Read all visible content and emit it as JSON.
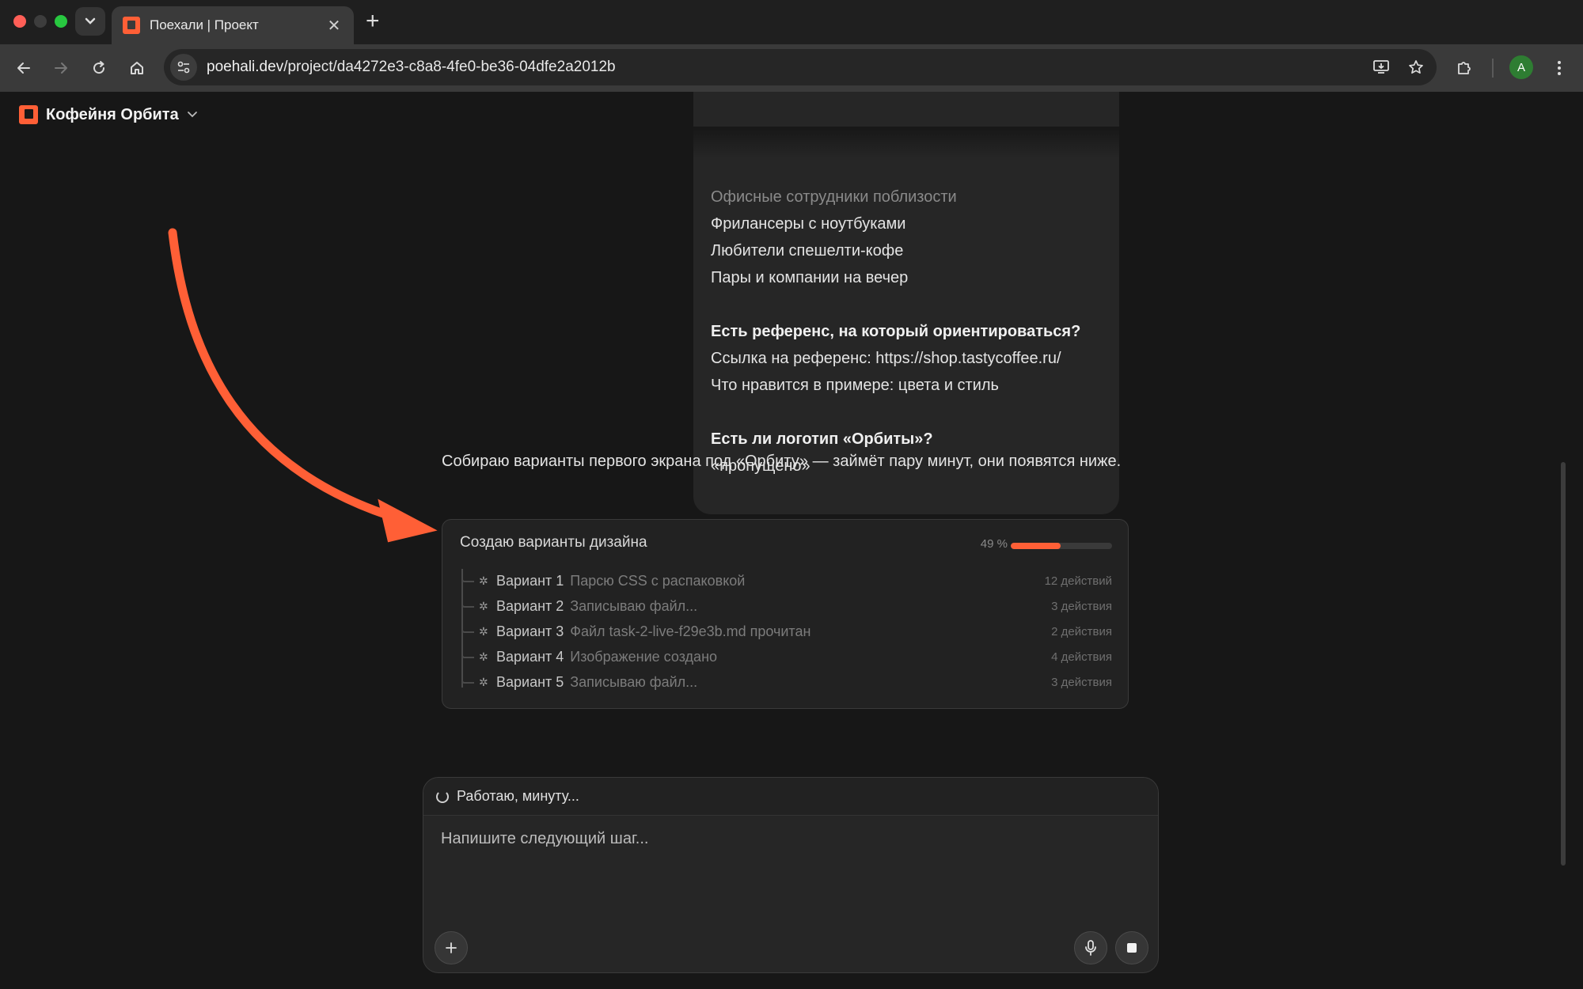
{
  "browser": {
    "tab_title": "Поехали | Проект",
    "url_host": "poehali.dev",
    "url_path": "/project/da4272e3-c8a8-4fe0-be36-04dfe2a2012b",
    "profile_initial": "A"
  },
  "header": {
    "project_name": "Кофейня Орбита"
  },
  "bubble": {
    "faded_line": "Офисные сотрудники поблизости",
    "audience": [
      "Фрилансеры с ноутбуками",
      "Любители спешелти-кофе",
      "Пары и компании на вечер"
    ],
    "q_reference": "Есть референс, на который ориентироваться?",
    "ref_link": "Ссылка на референс: https://shop.tastycoffee.ru/",
    "ref_like": "Что нравится в примере: цвета и стиль",
    "q_logo": "Есть ли логотип «Орбиты»?",
    "logo_answer": "«пропущено»"
  },
  "assistant": {
    "message": "Собираю варианты первого экрана под «Орбиту» — займёт пару минут, они появятся ниже."
  },
  "progress": {
    "title": "Создаю варианты дизайна",
    "percent_label": "49 %",
    "percent_value": 0.49,
    "variants": [
      {
        "name": "Вариант 1",
        "status": "Парсю CSS с распаковкой",
        "count": "12 действий"
      },
      {
        "name": "Вариант 2",
        "status": "Записываю файл...",
        "count": "3 действия"
      },
      {
        "name": "Вариант 3",
        "status": "Файл task-2-live-f29e3b.md прочитан",
        "count": "2 действия"
      },
      {
        "name": "Вариант 4",
        "status": "Изображение создано",
        "count": "4 действия"
      },
      {
        "name": "Вариант 5",
        "status": "Записываю файл...",
        "count": "3 действия"
      }
    ]
  },
  "composer": {
    "status": "Работаю, минуту...",
    "placeholder": "Напишите следующий шаг..."
  },
  "colors": {
    "accent": "#ff5f36",
    "background": "#171717"
  }
}
